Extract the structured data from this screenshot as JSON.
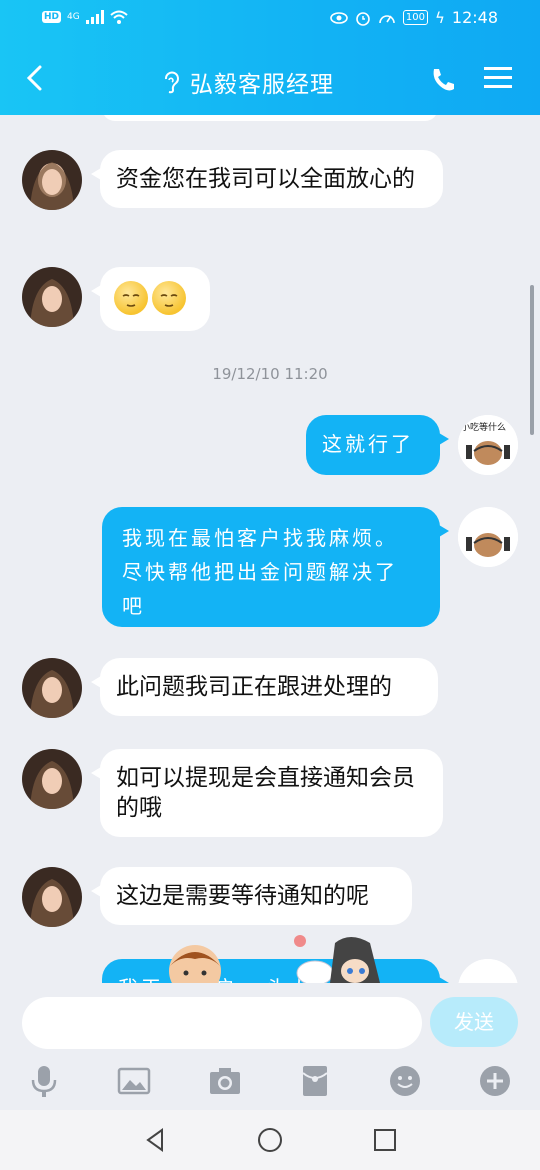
{
  "status": {
    "time": "12:48",
    "network": "4G",
    "battery": "100"
  },
  "header": {
    "title": "弘毅客服经理"
  },
  "messages": [
    {
      "side": "in",
      "text": "资金您在我司可以全面放心的"
    },
    {
      "side": "in",
      "text": ""
    },
    {
      "side": "out",
      "text": "这就行了"
    },
    {
      "side": "out",
      "text": "我现在最怕客户找我麻烦。尽快帮他把出金问题解决了吧"
    },
    {
      "side": "in",
      "text": "此问题我司正在跟进处理的"
    },
    {
      "side": "in",
      "text": "如可以提现是会直接通知会员的哦"
    },
    {
      "side": "in",
      "text": "这边是需要等待通知的呢"
    },
    {
      "side": "out",
      "text": "我天...客户...头大"
    }
  ],
  "timestamp": "19/12/10 11:20",
  "avatar_caption": "小吃等什么",
  "input": {
    "placeholder": "",
    "send_label": "发送"
  },
  "colors": {
    "accent": "#13b3f5",
    "background": "#eceef3"
  }
}
